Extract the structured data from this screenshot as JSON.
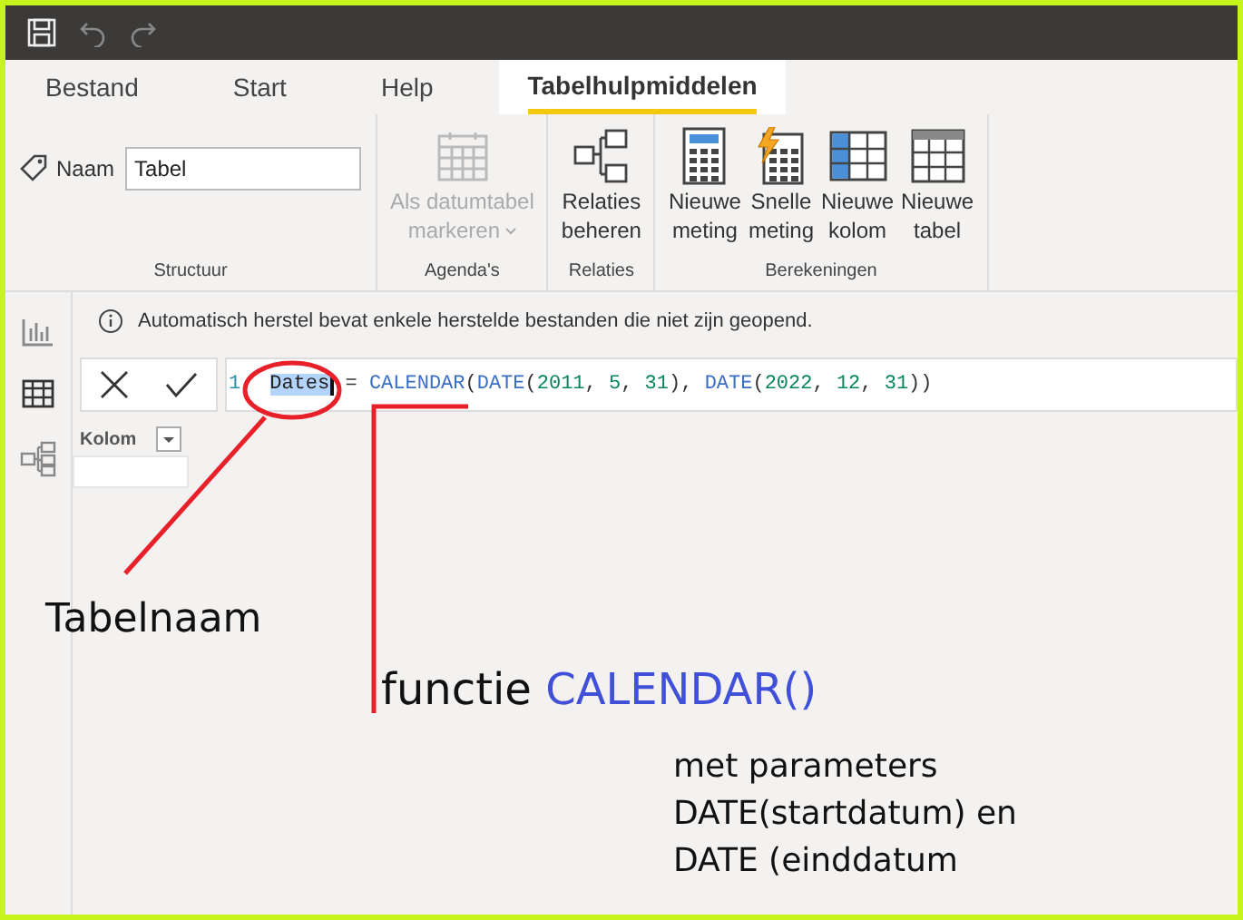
{
  "menu_tabs": [
    {
      "label": "Bestand",
      "selected": false
    },
    {
      "label": "Start",
      "selected": false
    },
    {
      "label": "Help",
      "selected": false
    },
    {
      "label": "Tabelhulpmiddelen",
      "selected": true
    }
  ],
  "ribbon": {
    "name_field": {
      "label": "Naam",
      "value": "Tabel",
      "group": "Structuur"
    },
    "groups": [
      {
        "label": "Agenda's",
        "buttons": [
          {
            "kind": "calendar",
            "lines": [
              "Als datumtabel",
              "markeren"
            ],
            "disabled": true,
            "dropdown": true
          }
        ]
      },
      {
        "label": "Relaties",
        "buttons": [
          {
            "kind": "relations",
            "lines": [
              "Relaties",
              "beheren"
            ],
            "disabled": false,
            "dropdown": false
          }
        ]
      },
      {
        "label": "Berekeningen",
        "buttons": [
          {
            "kind": "measure",
            "lines": [
              "Nieuwe",
              "meting"
            ],
            "disabled": false,
            "dropdown": false
          },
          {
            "kind": "quick-measure",
            "lines": [
              "Snelle",
              "meting"
            ],
            "disabled": false,
            "dropdown": false
          },
          {
            "kind": "column",
            "lines": [
              "Nieuwe",
              "kolom"
            ],
            "disabled": false,
            "dropdown": false
          },
          {
            "kind": "table",
            "lines": [
              "Nieuwe",
              "tabel"
            ],
            "disabled": false,
            "dropdown": false
          }
        ]
      }
    ]
  },
  "rail": [
    {
      "kind": "report",
      "selected": false
    },
    {
      "kind": "data",
      "selected": true
    },
    {
      "kind": "model",
      "selected": false
    }
  ],
  "notice": "Automatisch herstel bevat enkele herstelde bestanden die niet zijn geopend.",
  "formula": {
    "line_number": "1",
    "tokens": [
      {
        "text": "Dates",
        "kind": "name"
      },
      {
        "text": " = ",
        "kind": "punct"
      },
      {
        "text": "CALENDAR",
        "kind": "func"
      },
      {
        "text": "(",
        "kind": "punct"
      },
      {
        "text": "DATE",
        "kind": "func"
      },
      {
        "text": "(",
        "kind": "punct"
      },
      {
        "text": "2011",
        "kind": "num"
      },
      {
        "text": ", ",
        "kind": "punct"
      },
      {
        "text": "5",
        "kind": "num"
      },
      {
        "text": ", ",
        "kind": "punct"
      },
      {
        "text": "31",
        "kind": "num"
      },
      {
        "text": "), ",
        "kind": "punct"
      },
      {
        "text": "DATE",
        "kind": "func"
      },
      {
        "text": "(",
        "kind": "punct"
      },
      {
        "text": "2022",
        "kind": "num"
      },
      {
        "text": ", ",
        "kind": "punct"
      },
      {
        "text": "12",
        "kind": "num"
      },
      {
        "text": ", ",
        "kind": "punct"
      },
      {
        "text": "31",
        "kind": "num"
      },
      {
        "text": "))",
        "kind": "punct"
      }
    ]
  },
  "table": {
    "column_header": "Kolom"
  },
  "annotations": {
    "table_name": "Tabelnaam",
    "function_label": "functie",
    "function_name": "CALENDAR()",
    "parameters": [
      "met parameters",
      "DATE(startdatum) en",
      "DATE (einddatum"
    ]
  }
}
